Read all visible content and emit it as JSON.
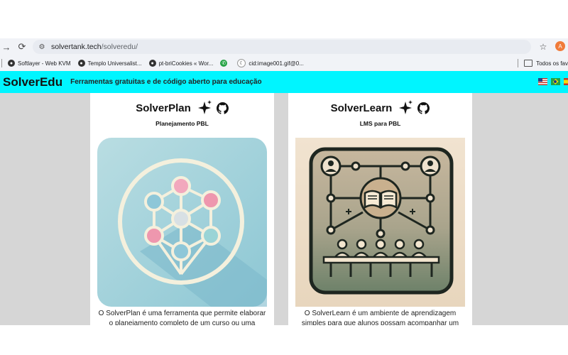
{
  "browser": {
    "url_host": "solvertank.tech",
    "url_path": "/solveredu/",
    "profile_initial": "A",
    "bookmarks": [
      {
        "label": "Softlayer - Web KVM",
        "icon": "globe-icon"
      },
      {
        "label": "Templo Universalist...",
        "icon": "globe-icon"
      },
      {
        "label": "pt-briCookies « Wor...",
        "icon": "globe-icon"
      },
      {
        "label": "",
        "icon": "whatsapp-icon"
      },
      {
        "label": "cid:image001.gif@0...",
        "icon": "moon-icon"
      }
    ],
    "all_bookmarks_label": "Todos os fav"
  },
  "site": {
    "logo": "SolverEdu",
    "tagline": "Ferramentas gratuitas e de código aberto para educação",
    "header_color": "#00f5ff"
  },
  "cards": [
    {
      "title": "SolverPlan",
      "subtitle": "Planejamento PBL",
      "description_line1": "O SolverPlan é uma ferramenta que permite elaborar",
      "description_line2": "o planejamento completo de um curso ou uma"
    },
    {
      "title": "SolverLearn",
      "subtitle": "LMS para PBL",
      "description_line1": "O SolverLearn é um ambiente de aprendizagem",
      "description_line2": "simples para que alunos possam acompanhar um"
    }
  ]
}
